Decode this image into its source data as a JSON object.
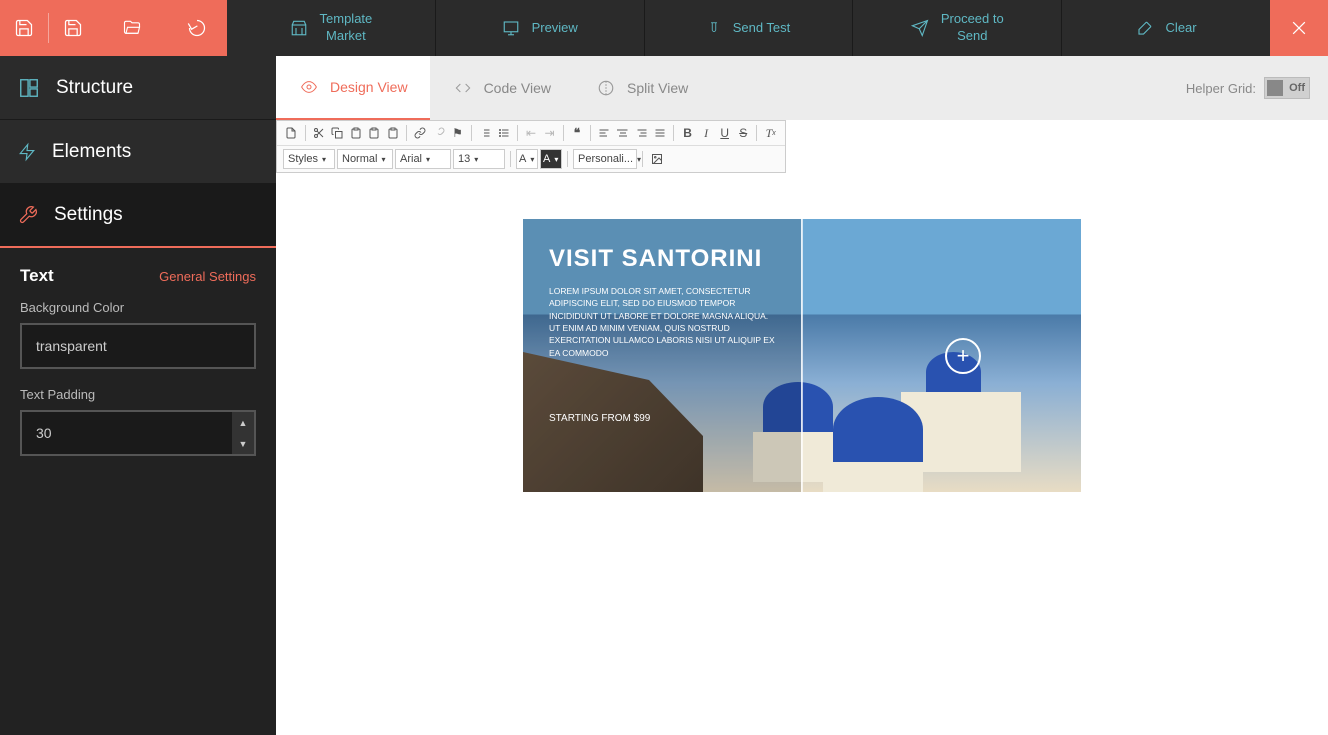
{
  "toolbar": {
    "template_market": "Template\nMarket",
    "preview": "Preview",
    "send_test": "Send Test",
    "proceed_to_send": "Proceed to\nSend",
    "clear": "Clear"
  },
  "sidebar": {
    "structure": "Structure",
    "elements": "Elements",
    "settings": "Settings"
  },
  "settings_panel": {
    "title": "Text",
    "general_link": "General Settings",
    "bg_label": "Background Color",
    "bg_value": "transparent",
    "padding_label": "Text Padding",
    "padding_value": "30"
  },
  "view_tabs": {
    "design": "Design View",
    "code": "Code View",
    "split": "Split View"
  },
  "helper_grid": {
    "label": "Helper Grid:",
    "state": "Off"
  },
  "rte": {
    "styles": "Styles",
    "format": "Normal",
    "font": "Arial",
    "size": "13",
    "text_color": "A",
    "bg_color": "A",
    "personalize": "Personali..."
  },
  "canvas": {
    "title": "VISIT SANTORINI",
    "body": "LOREM IPSUM DOLOR SIT AMET, CONSECTETUR ADIPISCING ELIT, SED DO EIUSMOD TEMPOR INCIDIDUNT UT LABORE ET DOLORE MAGNA ALIQUA. UT ENIM AD MINIM VENIAM, QUIS NOSTRUD EXERCITATION ULLAMCO LABORIS NISI UT ALIQUIP EX EA COMMODO",
    "price": "STARTING FROM $99"
  }
}
